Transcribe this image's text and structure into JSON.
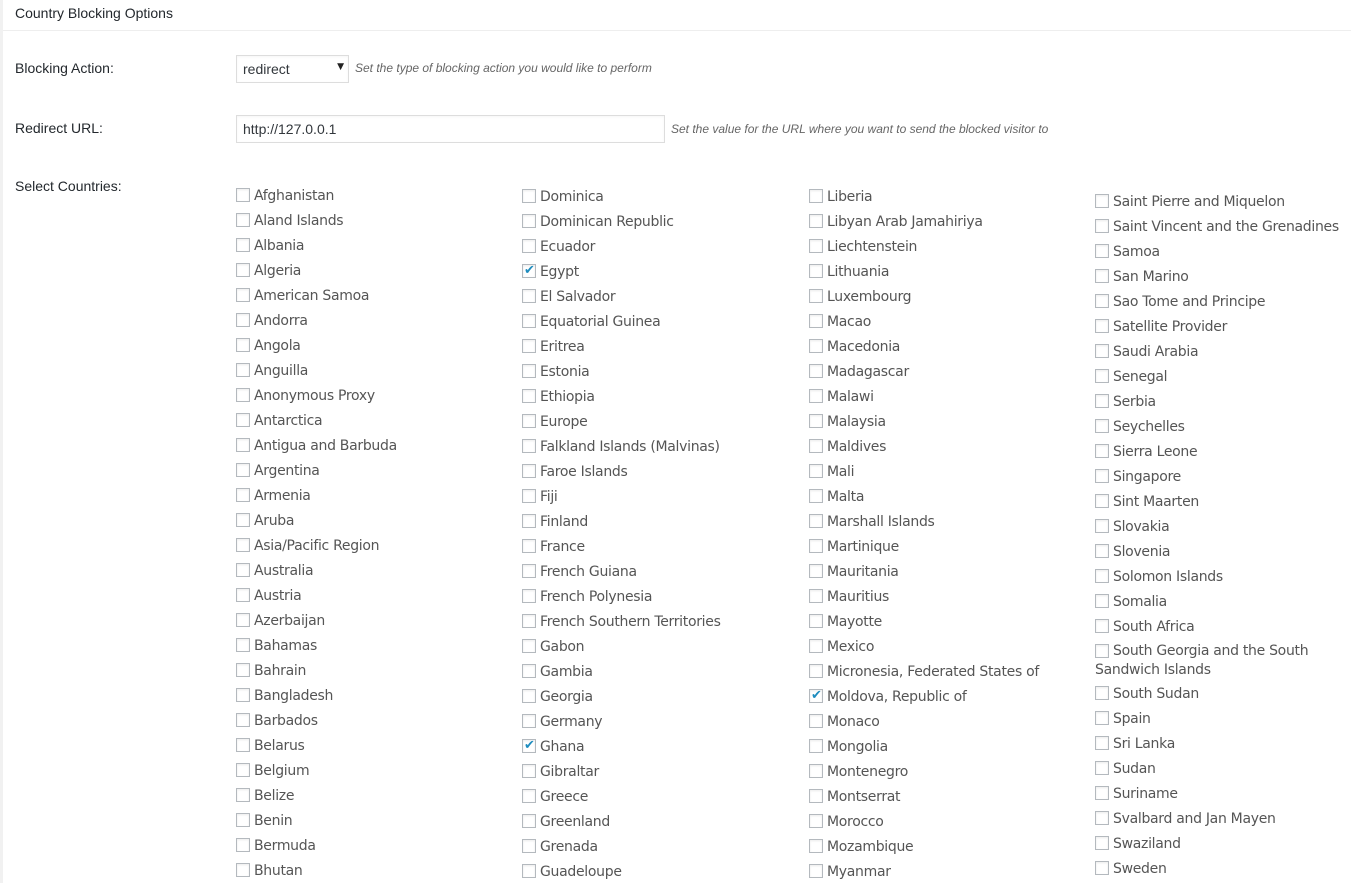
{
  "panel": {
    "title": "Country Blocking Options"
  },
  "blocking_action": {
    "label": "Blocking Action:",
    "selected": "redirect",
    "hint": "Set the type of blocking action you would like to perform"
  },
  "redirect_url": {
    "label": "Redirect URL:",
    "value": "http://127.0.0.1",
    "hint": "Set the value for the URL where you want to send the blocked visitor to"
  },
  "countries": {
    "label": "Select Countries:",
    "accent_color": "#1e8cbe",
    "columns": [
      [
        {
          "name": "Afghanistan",
          "checked": false
        },
        {
          "name": "Aland Islands",
          "checked": false
        },
        {
          "name": "Albania",
          "checked": false
        },
        {
          "name": "Algeria",
          "checked": false
        },
        {
          "name": "American Samoa",
          "checked": false
        },
        {
          "name": "Andorra",
          "checked": false
        },
        {
          "name": "Angola",
          "checked": false
        },
        {
          "name": "Anguilla",
          "checked": false
        },
        {
          "name": "Anonymous Proxy",
          "checked": false
        },
        {
          "name": "Antarctica",
          "checked": false
        },
        {
          "name": "Antigua and Barbuda",
          "checked": false
        },
        {
          "name": "Argentina",
          "checked": false
        },
        {
          "name": "Armenia",
          "checked": false
        },
        {
          "name": "Aruba",
          "checked": false
        },
        {
          "name": "Asia/Pacific Region",
          "checked": false
        },
        {
          "name": "Australia",
          "checked": false
        },
        {
          "name": "Austria",
          "checked": false
        },
        {
          "name": "Azerbaijan",
          "checked": false
        },
        {
          "name": "Bahamas",
          "checked": false
        },
        {
          "name": "Bahrain",
          "checked": false
        },
        {
          "name": "Bangladesh",
          "checked": false
        },
        {
          "name": "Barbados",
          "checked": false
        },
        {
          "name": "Belarus",
          "checked": false
        },
        {
          "name": "Belgium",
          "checked": false
        },
        {
          "name": "Belize",
          "checked": false
        },
        {
          "name": "Benin",
          "checked": false
        },
        {
          "name": "Bermuda",
          "checked": false
        },
        {
          "name": "Bhutan",
          "checked": false
        }
      ],
      [
        {
          "name": "Dominica",
          "checked": false
        },
        {
          "name": "Dominican Republic",
          "checked": false
        },
        {
          "name": "Ecuador",
          "checked": false
        },
        {
          "name": "Egypt",
          "checked": true
        },
        {
          "name": "El Salvador",
          "checked": false
        },
        {
          "name": "Equatorial Guinea",
          "checked": false
        },
        {
          "name": "Eritrea",
          "checked": false
        },
        {
          "name": "Estonia",
          "checked": false
        },
        {
          "name": "Ethiopia",
          "checked": false
        },
        {
          "name": "Europe",
          "checked": false
        },
        {
          "name": "Falkland Islands (Malvinas)",
          "checked": false
        },
        {
          "name": "Faroe Islands",
          "checked": false
        },
        {
          "name": "Fiji",
          "checked": false
        },
        {
          "name": "Finland",
          "checked": false
        },
        {
          "name": "France",
          "checked": false
        },
        {
          "name": "French Guiana",
          "checked": false
        },
        {
          "name": "French Polynesia",
          "checked": false
        },
        {
          "name": "French Southern Territories",
          "checked": false
        },
        {
          "name": "Gabon",
          "checked": false
        },
        {
          "name": "Gambia",
          "checked": false
        },
        {
          "name": "Georgia",
          "checked": false
        },
        {
          "name": "Germany",
          "checked": false
        },
        {
          "name": "Ghana",
          "checked": true
        },
        {
          "name": "Gibraltar",
          "checked": false
        },
        {
          "name": "Greece",
          "checked": false
        },
        {
          "name": "Greenland",
          "checked": false
        },
        {
          "name": "Grenada",
          "checked": false
        },
        {
          "name": "Guadeloupe",
          "checked": false
        }
      ],
      [
        {
          "name": "Liberia",
          "checked": false
        },
        {
          "name": "Libyan Arab Jamahiriya",
          "checked": false
        },
        {
          "name": "Liechtenstein",
          "checked": false
        },
        {
          "name": "Lithuania",
          "checked": false
        },
        {
          "name": "Luxembourg",
          "checked": false
        },
        {
          "name": "Macao",
          "checked": false
        },
        {
          "name": "Macedonia",
          "checked": false
        },
        {
          "name": "Madagascar",
          "checked": false
        },
        {
          "name": "Malawi",
          "checked": false
        },
        {
          "name": "Malaysia",
          "checked": false
        },
        {
          "name": "Maldives",
          "checked": false
        },
        {
          "name": "Mali",
          "checked": false
        },
        {
          "name": "Malta",
          "checked": false
        },
        {
          "name": "Marshall Islands",
          "checked": false
        },
        {
          "name": "Martinique",
          "checked": false
        },
        {
          "name": "Mauritania",
          "checked": false
        },
        {
          "name": "Mauritius",
          "checked": false
        },
        {
          "name": "Mayotte",
          "checked": false
        },
        {
          "name": "Mexico",
          "checked": false
        },
        {
          "name": "Micronesia, Federated States of",
          "checked": false
        },
        {
          "name": "Moldova, Republic of",
          "checked": true
        },
        {
          "name": "Monaco",
          "checked": false
        },
        {
          "name": "Mongolia",
          "checked": false
        },
        {
          "name": "Montenegro",
          "checked": false
        },
        {
          "name": "Montserrat",
          "checked": false
        },
        {
          "name": "Morocco",
          "checked": false
        },
        {
          "name": "Mozambique",
          "checked": false
        },
        {
          "name": "Myanmar",
          "checked": false
        }
      ],
      [
        {
          "name": "Saint Pierre and Miquelon",
          "checked": false
        },
        {
          "name": "Saint Vincent and the Grenadines",
          "checked": false
        },
        {
          "name": "Samoa",
          "checked": false
        },
        {
          "name": "San Marino",
          "checked": false
        },
        {
          "name": "Sao Tome and Principe",
          "checked": false
        },
        {
          "name": "Satellite Provider",
          "checked": false
        },
        {
          "name": "Saudi Arabia",
          "checked": false
        },
        {
          "name": "Senegal",
          "checked": false
        },
        {
          "name": "Serbia",
          "checked": false
        },
        {
          "name": "Seychelles",
          "checked": false
        },
        {
          "name": "Sierra Leone",
          "checked": false
        },
        {
          "name": "Singapore",
          "checked": false
        },
        {
          "name": "Sint Maarten",
          "checked": false
        },
        {
          "name": "Slovakia",
          "checked": false
        },
        {
          "name": "Slovenia",
          "checked": false
        },
        {
          "name": "Solomon Islands",
          "checked": false
        },
        {
          "name": "Somalia",
          "checked": false
        },
        {
          "name": "South Africa",
          "checked": false
        },
        {
          "name": "South Georgia and the South Sandwich Islands",
          "checked": false
        },
        {
          "name": "South Sudan",
          "checked": false
        },
        {
          "name": "Spain",
          "checked": false
        },
        {
          "name": "Sri Lanka",
          "checked": false
        },
        {
          "name": "Sudan",
          "checked": false
        },
        {
          "name": "Suriname",
          "checked": false
        },
        {
          "name": "Svalbard and Jan Mayen",
          "checked": false
        },
        {
          "name": "Swaziland",
          "checked": false
        },
        {
          "name": "Sweden",
          "checked": false
        }
      ]
    ]
  }
}
